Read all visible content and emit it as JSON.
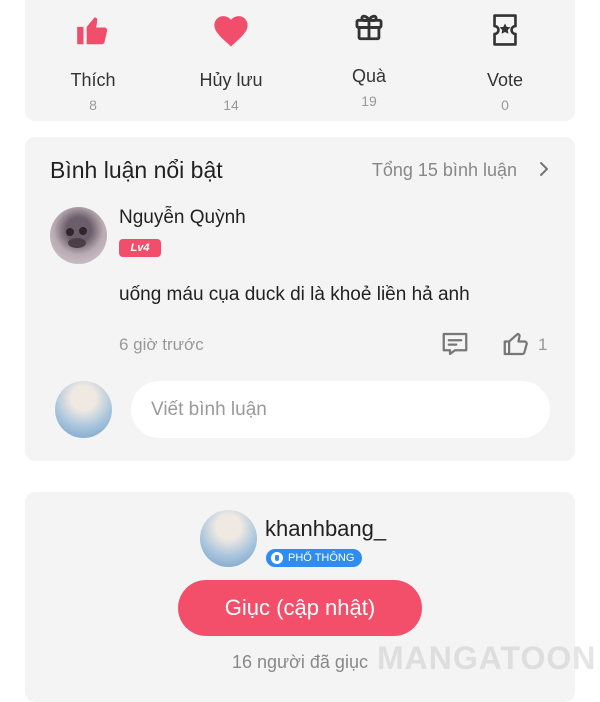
{
  "actions": [
    {
      "label": "Thích",
      "count": "8",
      "icon": "thumbs-up-icon",
      "color": "#f04e6b"
    },
    {
      "label": "Hủy lưu",
      "count": "14",
      "icon": "heart-icon",
      "color": "#f04e6b"
    },
    {
      "label": "Quà",
      "count": "19",
      "icon": "gift-icon",
      "color": "#333333"
    },
    {
      "label": "Vote",
      "count": "0",
      "icon": "vote-ticket-icon",
      "color": "#333333"
    }
  ],
  "comments": {
    "title": "Bình luận nổi bật",
    "total": "Tổng 15 bình luận",
    "item": {
      "author": "Nguyễn Quỳnh",
      "level": "Lv4",
      "text": "uống máu cụa duck di là khoẻ liền hả anh",
      "time": "6 giờ trước",
      "likes": "1"
    },
    "input_placeholder": "Viết bình luận"
  },
  "author": {
    "name": "khanhbang_",
    "badge": "PHỔ THÔNG",
    "urge_label": "Giục (cập nhật)",
    "urge_count": "16 người đã giục"
  },
  "watermark": "MANGATOON",
  "colors": {
    "accent": "#f34f6b",
    "badge_blue": "#2f8cf0",
    "card_bg": "#f4f4f5"
  }
}
